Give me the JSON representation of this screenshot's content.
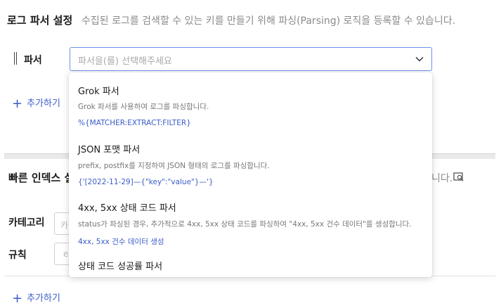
{
  "header": {
    "title": "로그 파서 설정",
    "description": "수집된 로그를 검색할 수 있는 키를 만들기 위해 파싱(Parsing) 로직을 등록할 수 있습니다."
  },
  "parser": {
    "label": "파서",
    "placeholder": "파서을(를) 선택해주세요",
    "add_label": "추가하기"
  },
  "dropdown": {
    "options": [
      {
        "title": "Grok 파서",
        "description": "Grok 파서를 사용하여 로그를 파싱합니다.",
        "example": "%{MATCHER:EXTRACT:FILTER}"
      },
      {
        "title": "JSON 포맷 파서",
        "description": "prefix, postfix를 지정하여 JSON 형태의 로그를 파싱합니다.",
        "example": "{'[2022-11-29]—{\"key\":\"value\"}—'}"
      },
      {
        "title": "4xx, 5xx 상태 코드 파서",
        "description": "status가 파싱된 경우, 추가적으로 4xx, 5xx 상태 코드를 파싱하여 \"4xx, 5xx 건수 데이터\"를 생성합니다.",
        "example": "4xx, 5xx 건수 데이터 생성"
      },
      {
        "title": "상태 코드 성공률 파서"
      }
    ]
  },
  "fast_index": {
    "title_visible": "빠른 인덱스 설",
    "desc_tail": "니다.",
    "category_label": "카테고리",
    "category_placeholder": "카",
    "rule_label": "규칙",
    "rule_placeholder": "e",
    "add_label": "추가하기"
  },
  "colors": {
    "accent": "#3b5cc8",
    "focus_border": "#6b8fe8"
  },
  "icons": {
    "chevron": "chevron-down-icon",
    "plus": "plus-icon",
    "doc_search": "document-search-icon"
  }
}
